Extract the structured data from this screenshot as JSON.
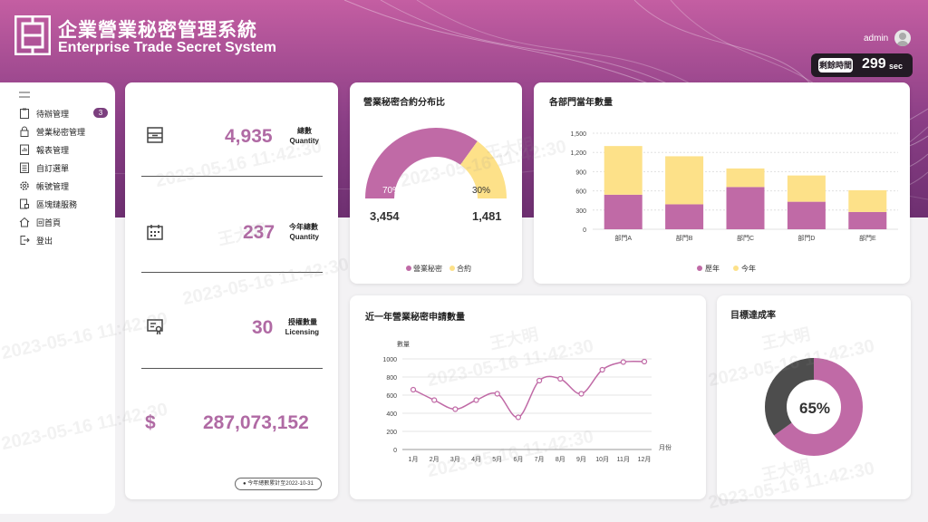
{
  "header": {
    "title_zh": "企業營業秘密管理系統",
    "title_en": "Enterprise Trade Secret System",
    "user": "admin",
    "timer_label": "剩餘時間",
    "timer_value": "299",
    "timer_unit": "sec"
  },
  "sidebar": {
    "items": [
      {
        "label": "待辦管理",
        "icon": "clipboard-icon",
        "badge": "3"
      },
      {
        "label": "營業秘密管理",
        "icon": "lock-icon"
      },
      {
        "label": "報表管理",
        "icon": "report-icon"
      },
      {
        "label": "自訂選單",
        "icon": "list-icon"
      },
      {
        "label": "帳號管理",
        "icon": "gear-icon"
      },
      {
        "label": "區塊鏈服務",
        "icon": "document-chain-icon"
      },
      {
        "label": "回首頁",
        "icon": "home-icon"
      },
      {
        "label": "登出",
        "icon": "logout-icon"
      }
    ]
  },
  "stats": {
    "total_label_zh": "總數",
    "total_label_en": "Quantity",
    "total_value": "4,935",
    "year_label_zh": "今年總數",
    "year_label_en": "Quantity",
    "year_value": "237",
    "license_label_zh": "授權數量",
    "license_label_en": "Licensing",
    "license_value": "30",
    "amount_symbol": "$",
    "amount_value": "287,073,152",
    "note": "● 今年總數累計至2022-10-31"
  },
  "gauge": {
    "title": "營業秘密合約分布比",
    "left_pct": "70%",
    "right_pct": "30%",
    "left_value": "3,454",
    "right_value": "1,481",
    "legend": [
      "營業秘密",
      "合約"
    ],
    "colors": [
      "#c06aa6",
      "#fde189"
    ]
  },
  "dept_chart": {
    "title": "各部門當年數量",
    "chart_data": {
      "type": "bar",
      "stacked": true,
      "categories": [
        "部門A",
        "部門B",
        "部門C",
        "部門D",
        "部門E"
      ],
      "series": [
        {
          "name": "歷年",
          "values": [
            540,
            390,
            660,
            430,
            270
          ],
          "color": "#c06aa6"
        },
        {
          "name": "今年",
          "values": [
            760,
            750,
            290,
            410,
            340
          ],
          "color": "#fde189"
        }
      ],
      "y_ticks": [
        "0",
        "300",
        "600",
        "900",
        "1,200",
        "1,500"
      ],
      "ylim": [
        0,
        1500
      ]
    }
  },
  "monthly_chart": {
    "title": "近一年營業秘密申請數量",
    "chart_data": {
      "type": "line",
      "categories": [
        "1月",
        "2月",
        "3月",
        "4月",
        "5月",
        "6月",
        "7月",
        "8月",
        "9月",
        "10月",
        "11月",
        "12月"
      ],
      "values": [
        660,
        545,
        445,
        545,
        615,
        355,
        760,
        780,
        615,
        880,
        965,
        970
      ],
      "y_ticks": [
        "0",
        "200",
        "400",
        "600",
        "800",
        "1000"
      ],
      "ylim": [
        0,
        1000
      ],
      "ylabel": "數量",
      "xlabel": "月份",
      "color": "#c06aa6"
    }
  },
  "target": {
    "title": "目標達成率",
    "percent_text": "65%",
    "chart_data": {
      "type": "pie",
      "values": [
        65,
        35
      ],
      "colors": [
        "#c06aa6",
        "#4d4d4d"
      ]
    }
  },
  "watermark": {
    "name": "王大明",
    "timestamp": "2023-05-16 11:42:30"
  }
}
